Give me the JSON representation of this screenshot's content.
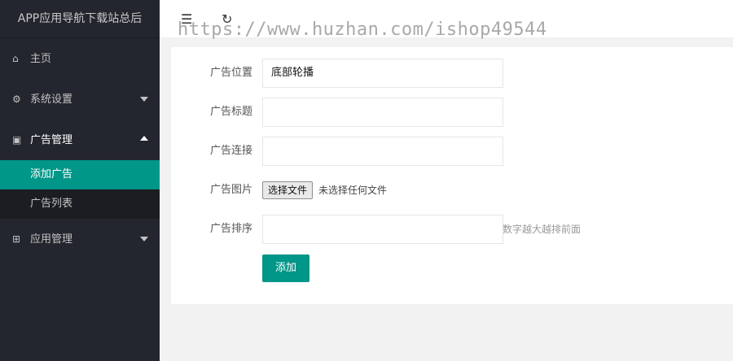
{
  "app_title": "APP应用导航下载站总后",
  "watermark": "https://www.huzhan.com/ishop49544",
  "toolbar": {
    "collapse_icon": "menu-collapse-icon",
    "refresh_icon": "refresh-icon"
  },
  "sidebar": {
    "home": "主页",
    "system_settings": "系统设置",
    "ad_management": "广告管理",
    "ad_sub": {
      "add": "添加广告",
      "list": "广告列表"
    },
    "app_management": "应用管理"
  },
  "form": {
    "position_label": "广告位置",
    "position_value": "底部轮播",
    "title_label": "广告标题",
    "title_value": "",
    "link_label": "广告连接",
    "link_value": "",
    "image_label": "广告图片",
    "file_button": "选择文件",
    "file_status": "未选择任何文件",
    "sort_label": "广告排序",
    "sort_value": "",
    "sort_tip": "数字越大越排前面",
    "submit": "添加"
  },
  "colors": {
    "accent": "#009688",
    "sidebar_bg": "#23262e",
    "page_bg": "#f2f2f2"
  }
}
